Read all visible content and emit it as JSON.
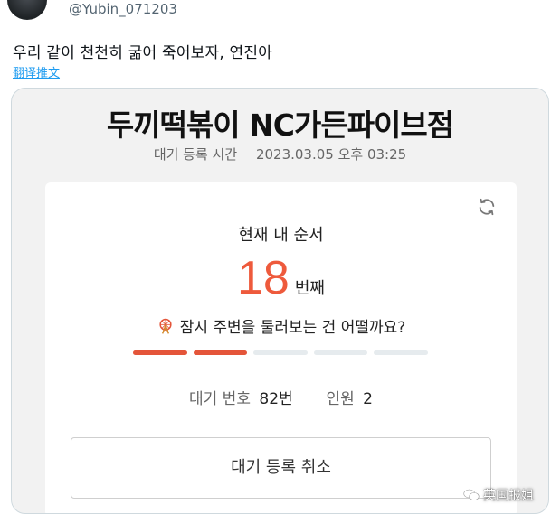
{
  "tweet": {
    "handle": "@Yubin_071203",
    "text": "우리 같이 천천히 굶어 죽어보자, 연진아",
    "translate_link": "翻译推文"
  },
  "screenshot": {
    "store_title": "두끼떡볶이 NC가든파이브점",
    "registration_label": "대기 등록 시간",
    "registration_time": "2023.03.05 오후 03:25",
    "card": {
      "title": "현재 내 순서",
      "order_number": "18",
      "order_unit": "번째",
      "suggestion": "잠시 주변을 둘러보는 건 어떨까요?",
      "progress": {
        "filled_segments": 2,
        "total_segments": 5
      },
      "wait_number_label": "대기 번호",
      "wait_number_value": "82번",
      "party_label": "인원",
      "party_value": "2",
      "cancel_button": "대기 등록 취소"
    },
    "accent_color": "#e4553a"
  },
  "watermark": "英国报姐"
}
